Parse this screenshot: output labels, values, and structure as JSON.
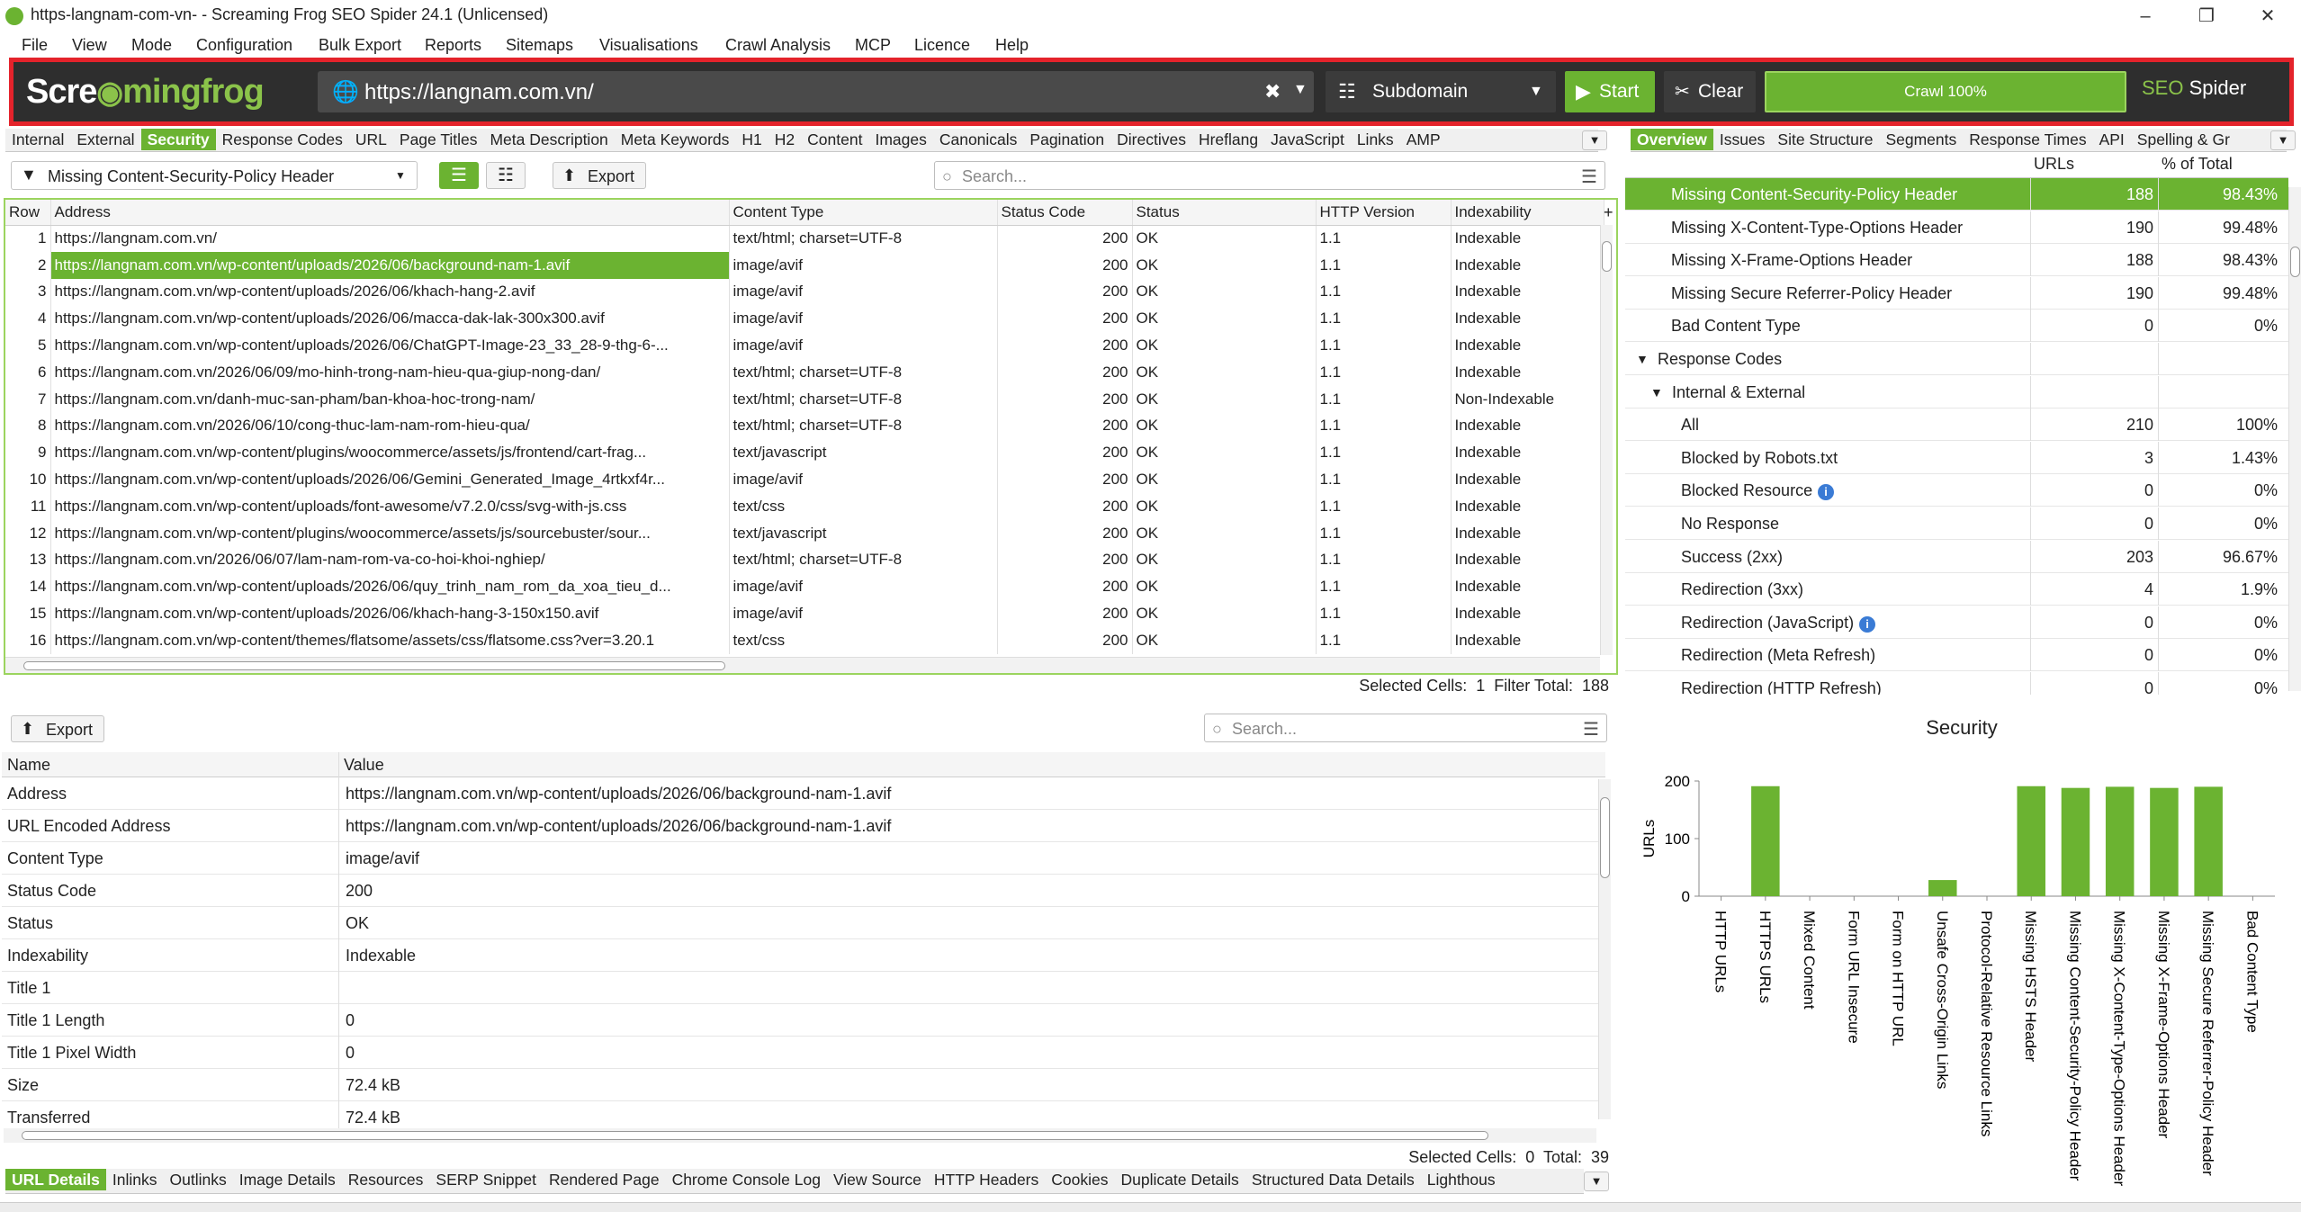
{
  "window": {
    "title": "https-langnam-com-vn- - Screaming Frog SEO Spider 24.1 (Unlicensed)"
  },
  "menu": [
    "File",
    "View",
    "Mode",
    "Configuration",
    "Bulk Export",
    "Reports",
    "Sitemaps",
    "Visualisations",
    "Crawl Analysis",
    "MCP",
    "Licence",
    "Help"
  ],
  "toolbar": {
    "logo_a": "Scre",
    "logo_b": "mingfrog",
    "url": "https://langnam.com.vn/",
    "mode": "Subdomain",
    "start_label": "Start",
    "clear_label": "Clear",
    "progress_label": "Crawl 100%",
    "progress": 1.0,
    "brand_a": "SEO",
    "brand_b": " Spider"
  },
  "main_tabs": [
    "Internal",
    "External",
    "Security",
    "Response Codes",
    "URL",
    "Page Titles",
    "Meta Description",
    "Meta Keywords",
    "H1",
    "H2",
    "Content",
    "Images",
    "Canonicals",
    "Pagination",
    "Directives",
    "Hreflang",
    "JavaScript",
    "Links",
    "AMP"
  ],
  "right_tabs": [
    "Overview",
    "Issues",
    "Site Structure",
    "Segments",
    "Response Times",
    "API",
    "Spelling & Gr"
  ],
  "filter": {
    "selected": "Missing Content-Security-Policy Header",
    "export_label": "Export",
    "search_placeholder": "Search..."
  },
  "table": {
    "headers": [
      "Row",
      "Address",
      "Content Type",
      "Status Code",
      "Status",
      "HTTP Version",
      "Indexability"
    ],
    "rows": [
      [
        "1",
        "https://langnam.com.vn/",
        "text/html; charset=UTF-8",
        "200",
        "OK",
        "1.1",
        "Indexable"
      ],
      [
        "2",
        "https://langnam.com.vn/wp-content/uploads/2026/06/background-nam-1.avif",
        "image/avif",
        "200",
        "OK",
        "1.1",
        "Indexable"
      ],
      [
        "3",
        "https://langnam.com.vn/wp-content/uploads/2026/06/khach-hang-2.avif",
        "image/avif",
        "200",
        "OK",
        "1.1",
        "Indexable"
      ],
      [
        "4",
        "https://langnam.com.vn/wp-content/uploads/2026/06/macca-dak-lak-300x300.avif",
        "image/avif",
        "200",
        "OK",
        "1.1",
        "Indexable"
      ],
      [
        "5",
        "https://langnam.com.vn/wp-content/uploads/2026/06/ChatGPT-Image-23_33_28-9-thg-6-...",
        "image/avif",
        "200",
        "OK",
        "1.1",
        "Indexable"
      ],
      [
        "6",
        "https://langnam.com.vn/2026/06/09/mo-hinh-trong-nam-hieu-qua-giup-nong-dan/",
        "text/html; charset=UTF-8",
        "200",
        "OK",
        "1.1",
        "Indexable"
      ],
      [
        "7",
        "https://langnam.com.vn/danh-muc-san-pham/ban-khoa-hoc-trong-nam/",
        "text/html; charset=UTF-8",
        "200",
        "OK",
        "1.1",
        "Non-Indexable"
      ],
      [
        "8",
        "https://langnam.com.vn/2026/06/10/cong-thuc-lam-nam-rom-hieu-qua/",
        "text/html; charset=UTF-8",
        "200",
        "OK",
        "1.1",
        "Indexable"
      ],
      [
        "9",
        "https://langnam.com.vn/wp-content/plugins/woocommerce/assets/js/frontend/cart-frag...",
        "text/javascript",
        "200",
        "OK",
        "1.1",
        "Indexable"
      ],
      [
        "10",
        "https://langnam.com.vn/wp-content/uploads/2026/06/Gemini_Generated_Image_4rtkxf4r...",
        "image/avif",
        "200",
        "OK",
        "1.1",
        "Indexable"
      ],
      [
        "11",
        "https://langnam.com.vn/wp-content/uploads/font-awesome/v7.2.0/css/svg-with-js.css",
        "text/css",
        "200",
        "OK",
        "1.1",
        "Indexable"
      ],
      [
        "12",
        "https://langnam.com.vn/wp-content/plugins/woocommerce/assets/js/sourcebuster/sour...",
        "text/javascript",
        "200",
        "OK",
        "1.1",
        "Indexable"
      ],
      [
        "13",
        "https://langnam.com.vn/2026/06/07/lam-nam-rom-va-co-hoi-khoi-nghiep/",
        "text/html; charset=UTF-8",
        "200",
        "OK",
        "1.1",
        "Indexable"
      ],
      [
        "14",
        "https://langnam.com.vn/wp-content/uploads/2026/06/quy_trinh_nam_rom_da_xoa_tieu_d...",
        "image/avif",
        "200",
        "OK",
        "1.1",
        "Indexable"
      ],
      [
        "15",
        "https://langnam.com.vn/wp-content/uploads/2026/06/khach-hang-3-150x150.avif",
        "image/avif",
        "200",
        "OK",
        "1.1",
        "Indexable"
      ],
      [
        "16",
        "https://langnam.com.vn/wp-content/themes/flatsome/assets/css/flatsome.css?ver=3.20.1",
        "text/css",
        "200",
        "OK",
        "1.1",
        "Indexable"
      ]
    ],
    "selected_row": 1,
    "status": "Selected Cells:  1  Filter Total:  188"
  },
  "overview": {
    "headers": [
      "URLs",
      "% of Total"
    ],
    "rows": [
      {
        "label": "Missing Content-Security-Policy Header",
        "n": "188",
        "p": "98.43%",
        "indent": 1,
        "hl": true
      },
      {
        "label": "Missing X-Content-Type-Options Header",
        "n": "190",
        "p": "99.48%",
        "indent": 1
      },
      {
        "label": "Missing X-Frame-Options Header",
        "n": "188",
        "p": "98.43%",
        "indent": 1
      },
      {
        "label": "Missing Secure Referrer-Policy Header",
        "n": "190",
        "p": "99.48%",
        "indent": 1
      },
      {
        "label": "Bad Content Type",
        "n": "0",
        "p": "0%",
        "indent": 1
      },
      {
        "label": "Response Codes",
        "n": "",
        "p": "",
        "indent": 0,
        "tree": true
      },
      {
        "label": "Internal & External",
        "n": "",
        "p": "",
        "indent": 1,
        "tree": true
      },
      {
        "label": "All",
        "n": "210",
        "p": "100%",
        "indent": 2
      },
      {
        "label": "Blocked by Robots.txt",
        "n": "3",
        "p": "1.43%",
        "indent": 2
      },
      {
        "label": "Blocked Resource",
        "n": "0",
        "p": "0%",
        "indent": 2,
        "info": true
      },
      {
        "label": "No Response",
        "n": "0",
        "p": "0%",
        "indent": 2
      },
      {
        "label": "Success (2xx)",
        "n": "203",
        "p": "96.67%",
        "indent": 2
      },
      {
        "label": "Redirection (3xx)",
        "n": "4",
        "p": "1.9%",
        "indent": 2
      },
      {
        "label": "Redirection (JavaScript)",
        "n": "0",
        "p": "0%",
        "indent": 2,
        "info": true
      },
      {
        "label": "Redirection (Meta Refresh)",
        "n": "0",
        "p": "0%",
        "indent": 2
      },
      {
        "label": "Redirection (HTTP Refresh)",
        "n": "0",
        "p": "0%",
        "indent": 2
      }
    ]
  },
  "details": {
    "export_label": "Export",
    "search_placeholder": "Search...",
    "headers": [
      "Name",
      "Value"
    ],
    "rows": [
      [
        "Address",
        "https://langnam.com.vn/wp-content/uploads/2026/06/background-nam-1.avif"
      ],
      [
        "URL Encoded Address",
        "https://langnam.com.vn/wp-content/uploads/2026/06/background-nam-1.avif"
      ],
      [
        "Content Type",
        "image/avif"
      ],
      [
        "Status Code",
        "200"
      ],
      [
        "Status",
        "OK"
      ],
      [
        "Indexability",
        "Indexable"
      ],
      [
        "Title 1",
        ""
      ],
      [
        "Title 1 Length",
        "0"
      ],
      [
        "Title 1 Pixel Width",
        "0"
      ],
      [
        "Size",
        "72.4 kB"
      ],
      [
        "Transferred",
        "72.4 kB"
      ]
    ],
    "status": "Selected Cells:  0  Total:  39"
  },
  "bottom_tabs": [
    "URL Details",
    "Inlinks",
    "Outlinks",
    "Image Details",
    "Resources",
    "SERP Snippet",
    "Rendered Page",
    "Chrome Console Log",
    "View Source",
    "HTTP Headers",
    "Cookies",
    "Duplicate Details",
    "Structured Data Details",
    "Lighthous"
  ],
  "chart_data": {
    "type": "bar",
    "title": "Security",
    "ylabel": "URLs",
    "ylim": [
      0,
      200
    ],
    "yticks": [
      0,
      100,
      200
    ],
    "categories": [
      "HTTP URLs",
      "HTTPS URLs",
      "Mixed Content",
      "Form URL Insecure",
      "Form on HTTP URL",
      "Unsafe Cross-Origin Links",
      "Protocol-Relative Resource Links",
      "Missing HSTS Header",
      "Missing Content-Security-Policy Header",
      "Missing X-Content-Type-Options Header",
      "Missing X-Frame-Options Header",
      "Missing Secure Referrer-Policy Header",
      "Bad Content Type"
    ],
    "values": [
      0,
      191,
      0,
      0,
      0,
      28,
      0,
      191,
      188,
      190,
      188,
      190,
      0
    ],
    "bar_color": "#6bb331"
  }
}
